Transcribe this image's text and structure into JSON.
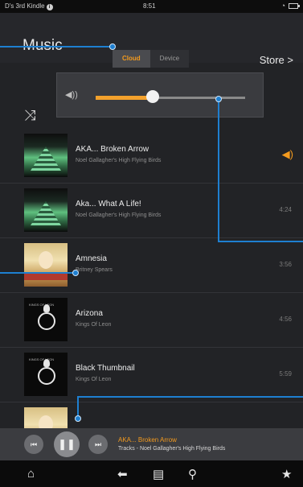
{
  "status_bar": {
    "device_name": "D's 3rd Kindle",
    "info_icon": "info-icon",
    "time": "8:51",
    "wifi_icon": "wifi-icon",
    "battery_icon": "battery-icon"
  },
  "header": {
    "title": "Music",
    "tabs": [
      {
        "label": "Cloud",
        "selected": true
      },
      {
        "label": "Device",
        "selected": false
      }
    ],
    "store_label": "Store >"
  },
  "volume": {
    "icon": "speaker-icon",
    "level": 0.38
  },
  "shuffle_icon": "shuffle-icon",
  "tracks": [
    {
      "title": "AKA... Broken Arrow",
      "artist": "Noel Gallagher's High Flying Birds",
      "duration": "",
      "now_playing": true,
      "art": "green"
    },
    {
      "title": "Aka... What A Life!",
      "artist": "Noel Gallagher's High Flying Birds",
      "duration": "4:24",
      "now_playing": false,
      "art": "green"
    },
    {
      "title": "Amnesia",
      "artist": "Britney Spears",
      "duration": "3:56",
      "now_playing": false,
      "art": "britney"
    },
    {
      "title": "Arizona",
      "artist": "Kings Of Leon",
      "duration": "4:56",
      "now_playing": false,
      "art": "black"
    },
    {
      "title": "Black Thumbnail",
      "artist": "Kings Of Leon",
      "duration": "5:59",
      "now_playing": false,
      "art": "black"
    }
  ],
  "player": {
    "prev_icon": "previous-icon",
    "pause_icon": "pause-icon",
    "next_icon": "next-icon",
    "now_playing_title": "AKA... Broken Arrow",
    "now_playing_subtitle": "Tracks - Noel Gallagher's High Flying Birds"
  },
  "nav": {
    "icons": [
      "home-icon",
      "back-icon",
      "menu-icon",
      "search-icon",
      "favorites-icon"
    ]
  },
  "colors": {
    "accent": "#f39a1e",
    "callout": "#1e7fd0",
    "background": "#222326"
  }
}
